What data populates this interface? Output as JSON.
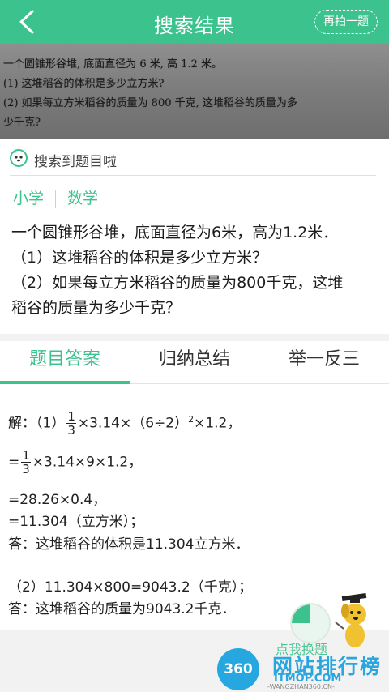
{
  "header": {
    "title": "搜索结果",
    "retake_label": "再拍一题"
  },
  "photo": {
    "lines": [
      "一个圆锥形谷堆, 底面直径为 6 米, 高 1.2 米。",
      "(1) 这堆稻谷的体积是多少立方米?",
      "(2) 如果每立方米稻谷的质量为 800 千克, 这堆稻谷的质量为多",
      "少千克?"
    ]
  },
  "result": {
    "found_text": "搜索到题目啦",
    "tags": [
      "小学",
      "数学"
    ],
    "question_lines": [
      "一个圆锥形谷堆，底面直径为6米，高为1.2米．",
      "（1）这堆稻谷的体积是多少立方米？",
      "（2）如果每立方米稻谷的质量为800千克，这堆",
      "稻谷的质量为多少千克？"
    ]
  },
  "tabs": [
    {
      "label": "题目答案",
      "active": true
    },
    {
      "label": "归纳总结",
      "active": false
    },
    {
      "label": "举一反三",
      "active": false
    }
  ],
  "answer": {
    "line1_prefix": "解：（1）",
    "frac_num": "1",
    "frac_den": "3",
    "line1_suffix": "×3.14×（6÷2）",
    "line1_sup": "2",
    "line1_tail": "×1.2，",
    "line2_prefix": "=",
    "line2_suffix": "×3.14×9×1.2，",
    "line3": "=28.26×0.4，",
    "line4": "=11.304（立方米）；",
    "line5": "答：这堆稻谷的体积是11.304立方米．",
    "line6": "（2）11.304×800=9043.2（千克）；",
    "line7": "答：这堆稻谷的质量为9043.2千克．"
  },
  "footer": {
    "ask_text": "点我换题"
  },
  "watermark": {
    "logo": "360",
    "text": "网站排行榜",
    "sub1": "ITMOP.COM",
    "sub2": "-WANGZHAN360.CN-"
  },
  "colors": {
    "accent": "#3cc28d",
    "watermark": "#2aa6df"
  }
}
